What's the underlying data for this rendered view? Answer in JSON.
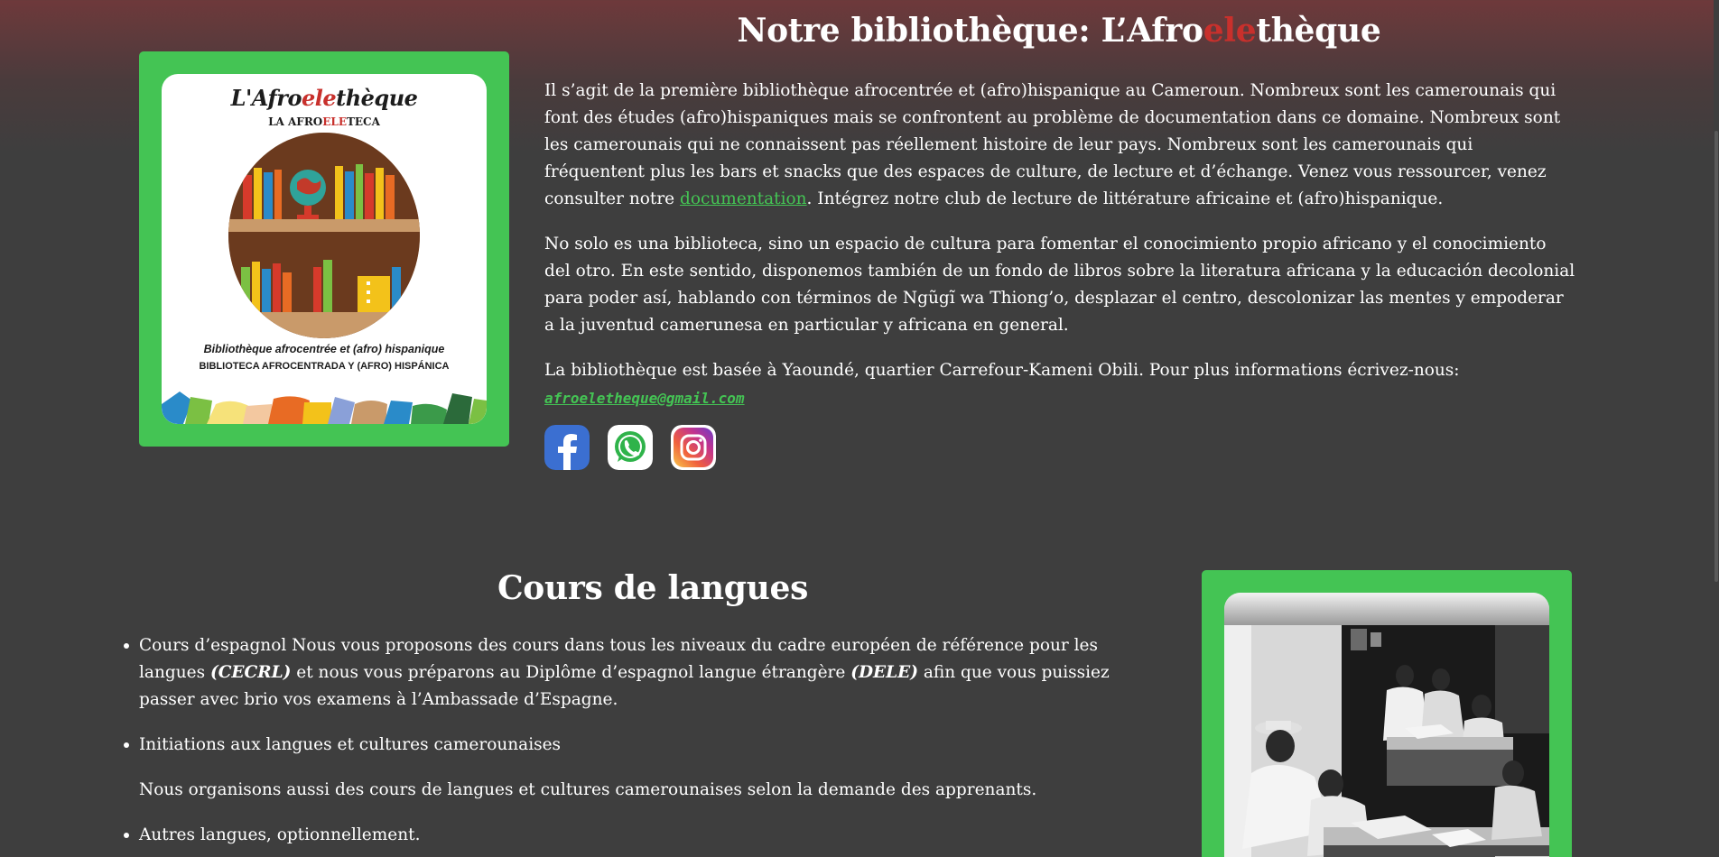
{
  "library": {
    "title_part1": "Notre bibliothèque: L’Afro",
    "title_accent": "ele",
    "title_part2": "thèque",
    "poster": {
      "title_part1": "L'Afro",
      "title_accent": "ele",
      "title_part2": "thèque",
      "subtitle_part1": "LA AFRO",
      "subtitle_accent": "ELE",
      "subtitle_part2": "TECA",
      "caption1": "Bibliothèque afrocentrée et (afro) hispanique",
      "caption2": "BIBLIOTECA AFROCENTRADA Y (AFRO) HISPÁNICA"
    },
    "paragraph1_before_link": "Il s’agit de la première bibliothèque afrocentrée et (afro)hispanique au Cameroun. Nombreux sont les camerounais qui font des études (afro)hispaniques mais se confrontent au problème de documentation dans ce domaine. Nombreux sont les camerounais qui ne connaissent pas réellement histoire de leur pays. Nombreux sont les camerounais qui fréquentent plus les bars et snacks que des espaces de culture, de lecture et d’échange. Venez vous ressourcer, venez consulter notre ",
    "paragraph1_link": "documentation",
    "paragraph1_after_link": ". Intégrez notre club de lecture de littérature africaine et (afro)hispanique.",
    "paragraph2": "No solo es una biblioteca, sino un espacio de cultura para fomentar el conocimiento propio africano y el conocimiento del otro. En este sentido, disponemos también de un fondo de libros sobre la literatura africana y la educación decolonial para poder así, hablando con términos de Ngũgĩ wa Thiong’o, desplazar el centro, descolonizar las mentes y empoderar a la juventud camerunesa en particular y africana en general.",
    "paragraph3": "La bibliothèque est basée à Yaoundé, quartier Carrefour-Kameni Obili. Pour plus informations écrivez-nous:",
    "email": "afroeletheque@gmail.com",
    "socials": [
      "facebook-icon",
      "whatsapp-icon",
      "instagram-icon"
    ]
  },
  "courses": {
    "title": "Cours de langues",
    "item1_text1": "Cours d’espagnol Nous vous proposons des cours dans tous les niveaux du cadre européen de référence pour les langues ",
    "item1_em1": "(CECRL)",
    "item1_text2": " et nous vous préparons au Diplôme d’espagnol langue étrangère ",
    "item1_em2": "(DELE)",
    "item1_text3": " afin que vous puissiez passer avec brio vos examens à l’Ambassade d’Espagne.",
    "item2": "Initiations aux langues et cultures camerounaises",
    "item2_note": "Nous organisons aussi des cours de langues et cultures camerounaises selon la demande des apprenants.",
    "item3": "Autres langues, optionnellement."
  },
  "colors": {
    "accent_green": "#44c454",
    "accent_red": "#c8302c",
    "background": "#3e3e3e"
  }
}
